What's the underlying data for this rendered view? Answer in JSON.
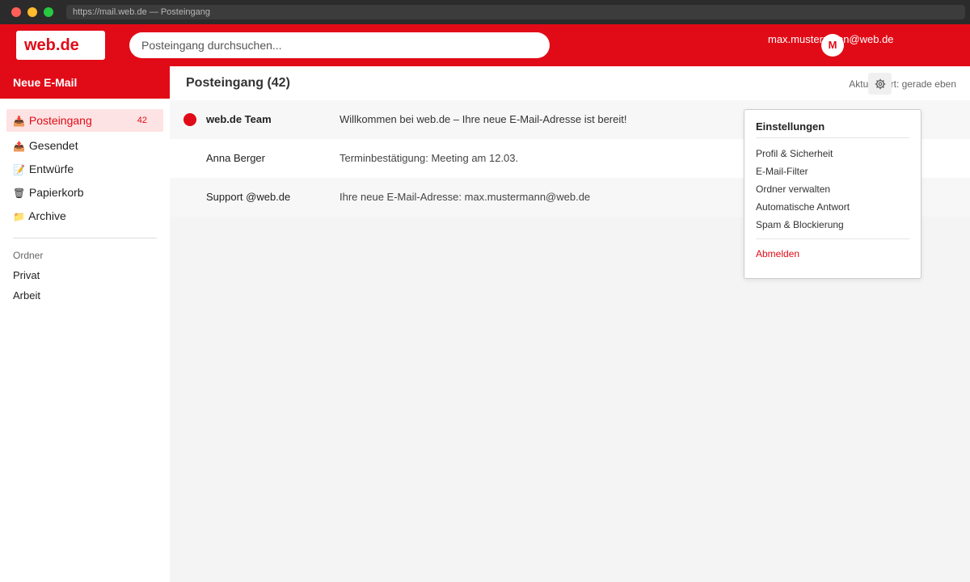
{
  "browser": {
    "url": "https://mail.web.de — Posteingang"
  },
  "header": {
    "logo": "web.de",
    "search_placeholder": "Posteingang durchsuchen...",
    "user_email": "max.mustermann@web.de",
    "avatar_initial": "M"
  },
  "sidebar": {
    "compose_label": "Neue E-Mail",
    "nav": [
      {
        "label": "Posteingang",
        "count": "42",
        "icon": "inbox-icon",
        "glyph": "📥"
      },
      {
        "label": "Gesendet",
        "icon": "sent-icon",
        "glyph": "📤"
      },
      {
        "label": "Entwürfe",
        "icon": "draft-icon",
        "glyph": "📝"
      },
      {
        "label": "Papierkorb",
        "icon": "trash-icon",
        "glyph": "🗑"
      },
      {
        "label": "Archive",
        "icon": "archive-icon",
        "glyph": "📁"
      }
    ],
    "folders_title": "Ordner",
    "folders": [
      "Privat",
      "Arbeit"
    ]
  },
  "main": {
    "title": "Posteingang (42)",
    "updated": "Aktualisiert: gerade eben",
    "mails": [
      {
        "sender": "web.de Team",
        "subject": "Willkommen bei web.de – Ihre neue E-Mail-Adresse ist bereit!",
        "unread": true
      },
      {
        "sender": "Anna Berger",
        "subject": "Terminbestätigung: Meeting am 12.03.",
        "unread": false
      },
      {
        "sender": "Support @web.de",
        "subject": "Ihre neue E-Mail-Adresse: max.mustermann@web.de",
        "unread": false
      }
    ]
  },
  "settings_menu": {
    "title": "Einstellungen",
    "items": [
      "Profil & Sicherheit",
      "E-Mail-Filter",
      "Ordner verwalten",
      "Automatische Antwort",
      "Spam & Blockierung"
    ],
    "logout": "Abmelden"
  },
  "colors": {
    "brand_red": "#e10b17",
    "active_bg": "#fde3e3"
  }
}
